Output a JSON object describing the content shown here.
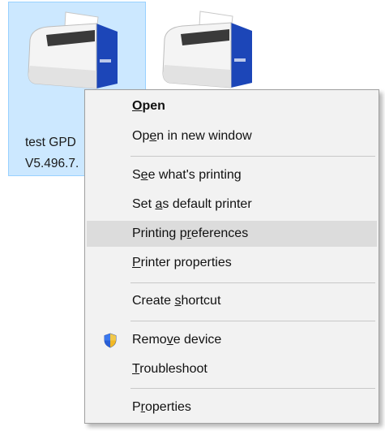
{
  "devices": [
    {
      "label_line1": "test GPD",
      "label_line2": "V5.496.7.",
      "selected": true
    },
    {
      "label_line1": "",
      "label_line2": "",
      "selected": false
    }
  ],
  "menu": {
    "items": [
      {
        "id": "open",
        "parts": [
          "",
          "O",
          "pen"
        ]
      },
      {
        "id": "open-new-window",
        "parts": [
          "Op",
          "e",
          "n in new window"
        ]
      },
      {
        "id": "see-whats-printing",
        "parts": [
          "S",
          "e",
          "e what's printing"
        ]
      },
      {
        "id": "set-default",
        "parts": [
          "Set ",
          "a",
          "s default printer"
        ]
      },
      {
        "id": "printing-preferences",
        "parts": [
          "Printing p",
          "r",
          "eferences"
        ]
      },
      {
        "id": "printer-properties",
        "parts": [
          "",
          "P",
          "rinter properties"
        ]
      },
      {
        "id": "create-shortcut",
        "parts": [
          "Create ",
          "s",
          "hortcut"
        ]
      },
      {
        "id": "remove-device",
        "parts": [
          "Remo",
          "v",
          "e device"
        ]
      },
      {
        "id": "troubleshoot",
        "parts": [
          "",
          "T",
          "roubleshoot"
        ]
      },
      {
        "id": "properties",
        "parts": [
          "P",
          "r",
          "operties"
        ]
      }
    ]
  },
  "colors": {
    "selection_bg": "#cce8ff",
    "menu_bg": "#f2f2f2",
    "menu_hover": "#dcdcdc",
    "printer_blue": "#1c46b8"
  },
  "icons": {
    "printer": "printer-icon",
    "shield": "uac-shield-icon"
  }
}
